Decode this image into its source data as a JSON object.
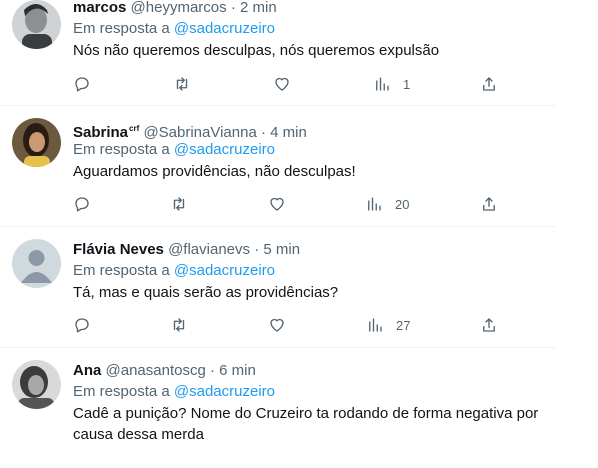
{
  "tweets": [
    {
      "name": "marcos",
      "badge": "",
      "handle": "@heyymarcos",
      "time": "2 min",
      "reply_prefix": "Em resposta a",
      "reply_to": "@sadacruzeiro",
      "text": "Nós não queremos desculpas, nós queremos expulsão",
      "views": "1",
      "avatar": "dark-portrait"
    },
    {
      "name": "Sabrina",
      "badge": "crf",
      "handle": "@SabrinaVianna",
      "time": "4 min",
      "reply_prefix": "Em resposta a",
      "reply_to": "@sadacruzeiro",
      "text": "Aguardamos providências, não desculpas!",
      "views": "20",
      "avatar": "photo-portrait"
    },
    {
      "name": "Flávia Neves",
      "badge": "",
      "handle": "@flavianevs",
      "time": "5 min",
      "reply_prefix": "Em resposta a",
      "reply_to": "@sadacruzeiro",
      "text": "Tá, mas e quais serão as providências?",
      "views": "27",
      "avatar": "default-avatar"
    },
    {
      "name": "Ana",
      "badge": "",
      "handle": "@anasantoscg",
      "time": "6 min",
      "reply_prefix": "Em resposta a",
      "reply_to": "@sadacruzeiro",
      "text": "Cadê a punição? Nome do Cruzeiro ta rodando de forma negativa por causa dessa merda",
      "views": "",
      "avatar": "grayscale-portrait"
    }
  ],
  "separator": "·",
  "icons": [
    "reply-icon",
    "retweet-icon",
    "like-icon",
    "views-icon",
    "share-icon"
  ],
  "colors": {
    "text": "#0f1419",
    "secondary": "#536471",
    "link": "#1d9bf0",
    "divider": "#eff3f4"
  }
}
